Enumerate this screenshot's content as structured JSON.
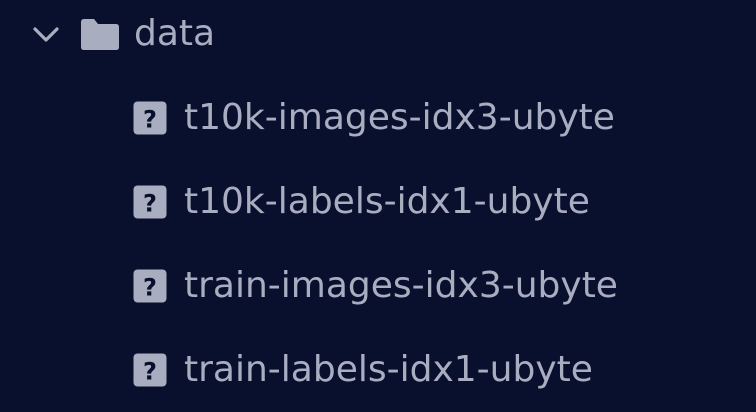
{
  "explorer": {
    "folder": {
      "name": "data",
      "expanded": true,
      "chevron_icon": "chevron-down-icon",
      "folder_icon": "folder-icon"
    },
    "files": [
      {
        "name": "t10k-images-idx3-ubyte",
        "icon": "unknown-file-icon"
      },
      {
        "name": "t10k-labels-idx1-ubyte",
        "icon": "unknown-file-icon"
      },
      {
        "name": "train-images-idx3-ubyte",
        "icon": "unknown-file-icon"
      },
      {
        "name": "train-labels-idx1-ubyte",
        "icon": "unknown-file-icon"
      }
    ]
  },
  "colors": {
    "background": "#08102e",
    "text": "#a8aec0",
    "icon": "#a8aec0",
    "icon_glyph": "#08102e"
  }
}
